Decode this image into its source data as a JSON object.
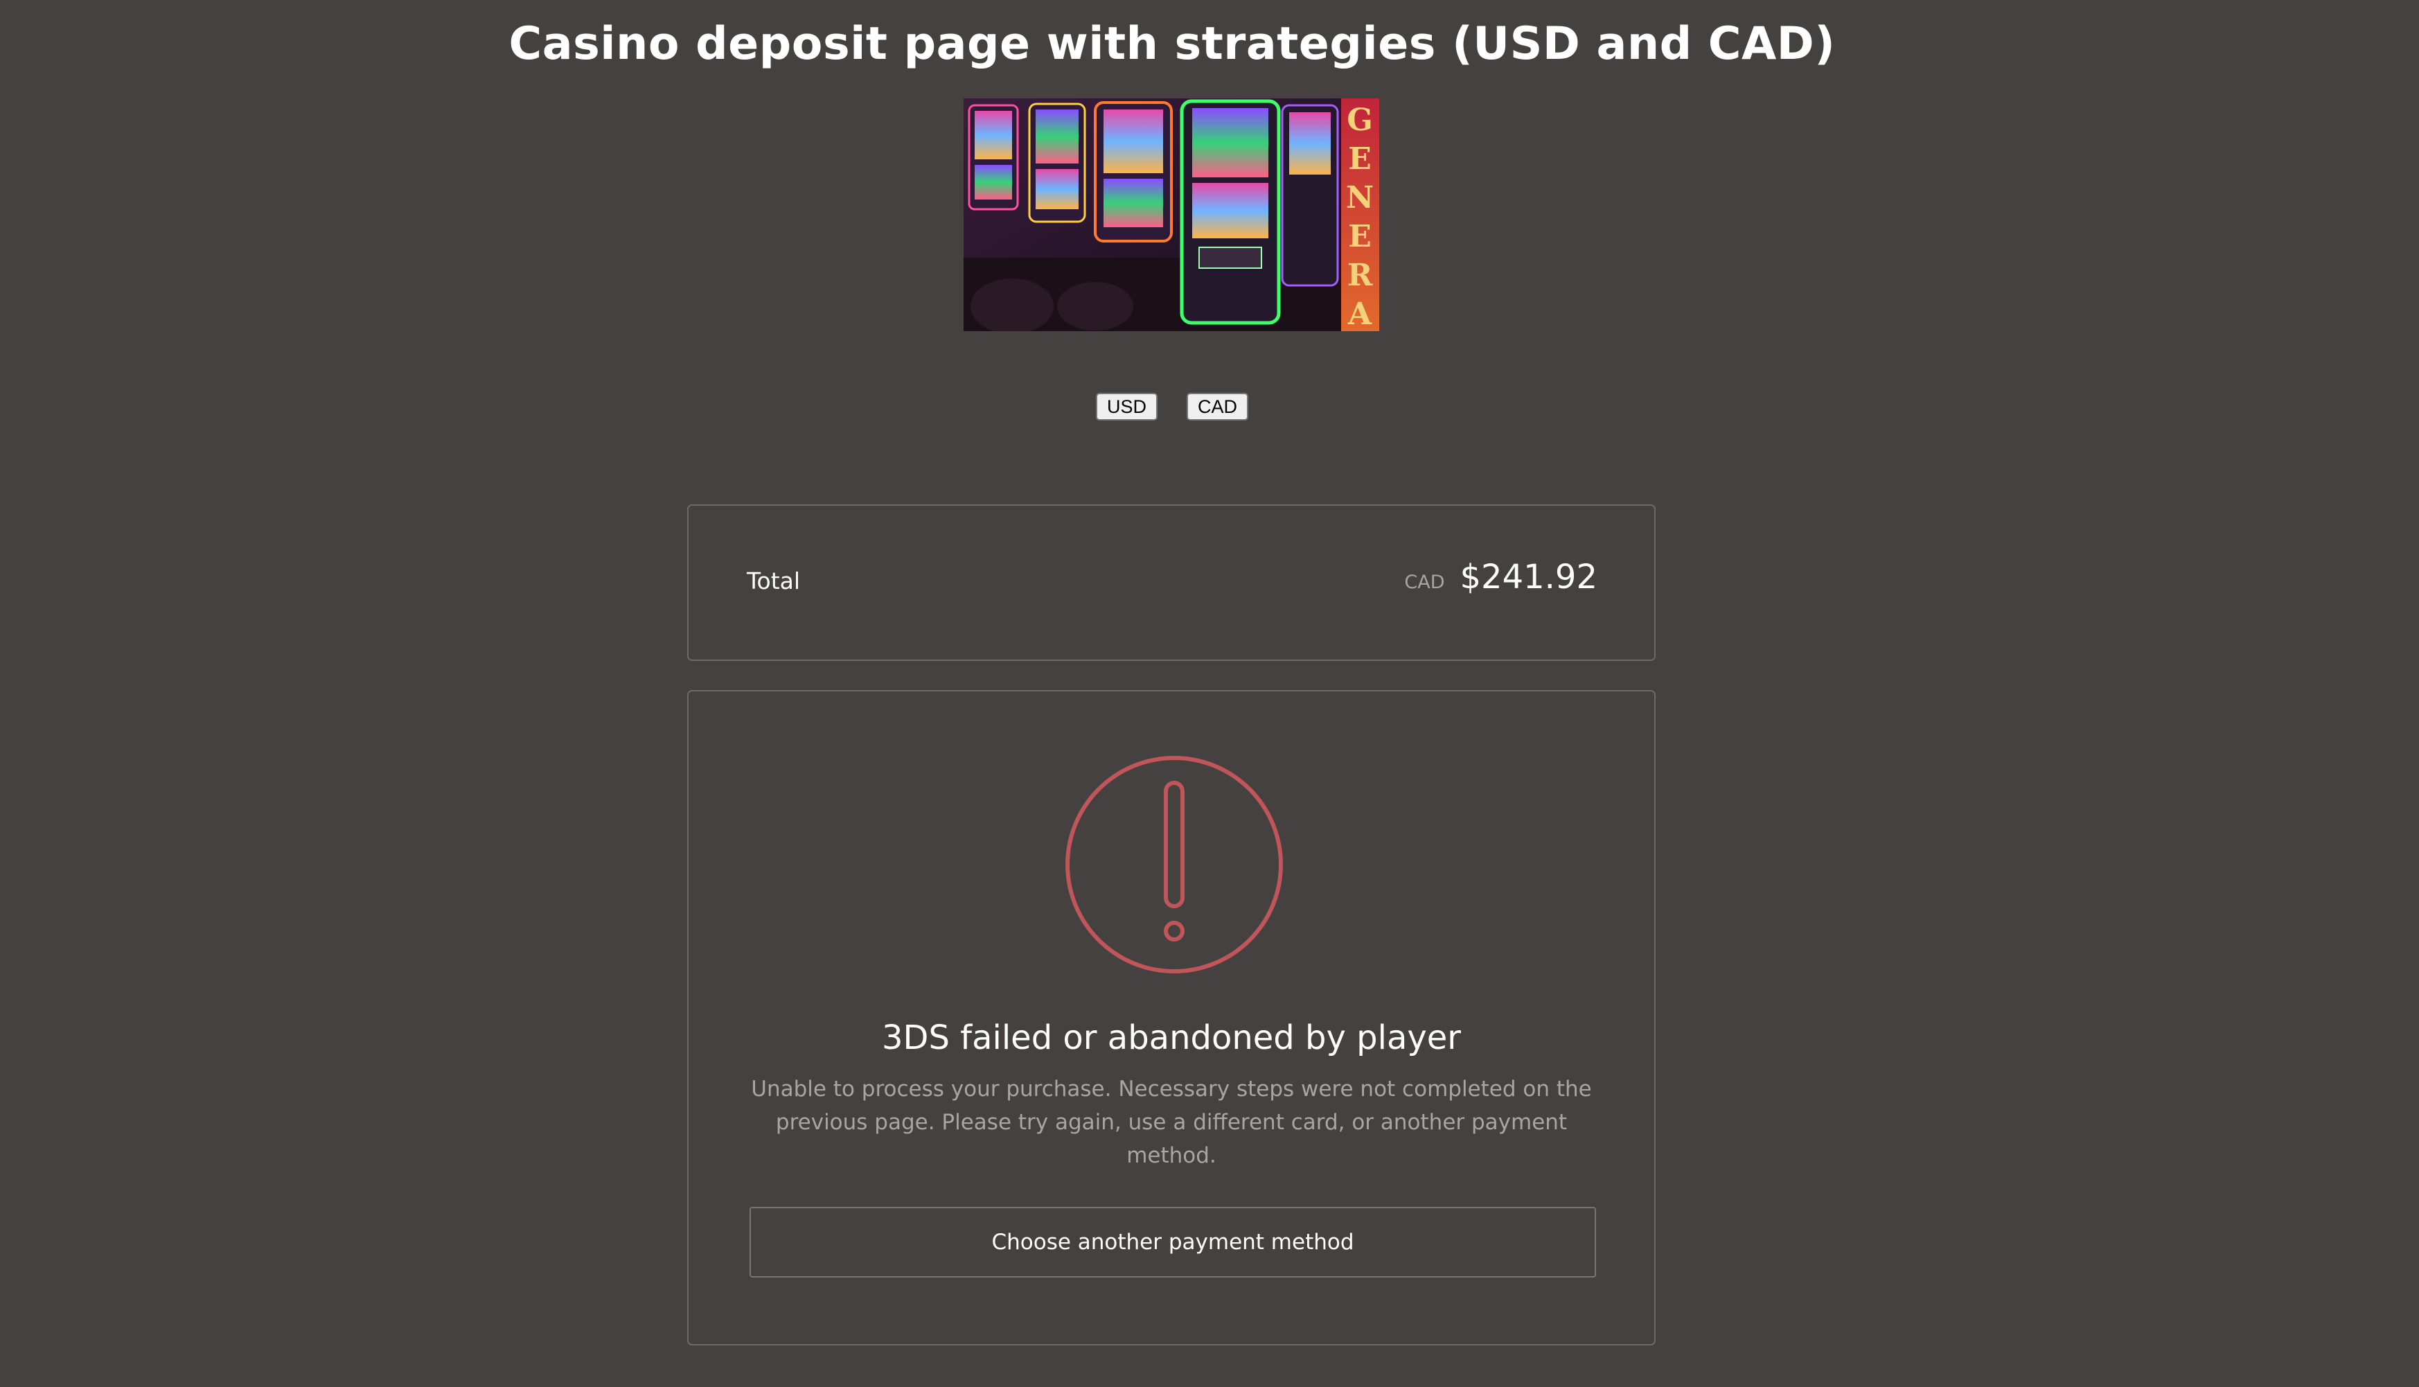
{
  "page": {
    "title": "Casino deposit page with strategies (USD and CAD)"
  },
  "hero": {
    "image_name": "casino-slot-machines-image",
    "sign_text": "GENERA"
  },
  "currency_toggle": {
    "usd_label": "USD",
    "cad_label": "CAD"
  },
  "total": {
    "label": "Total",
    "currency": "CAD",
    "amount": "$241.92"
  },
  "error": {
    "icon": "exclamation-circle-icon",
    "title": "3DS failed or abandoned by player",
    "description": "Unable to process your purchase. Necessary steps were not completed on the previous page. Please try again, use a different card, or another payment method.",
    "action_label": "Choose another payment method"
  },
  "colors": {
    "background": "#454140",
    "card_border": "#6f6a69",
    "error_accent": "#c0555a",
    "muted_text": "#a9a5a4"
  }
}
